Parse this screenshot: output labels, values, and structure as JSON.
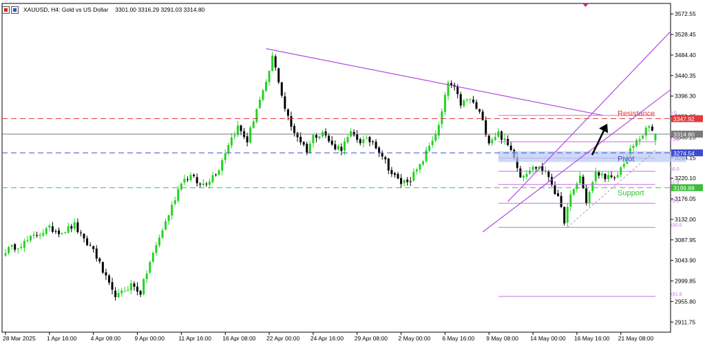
{
  "header": {
    "symbol_desc": "XAUUSD, H4:  Gold vs US Dollar",
    "ohlc": "3301.00 3316.29 3291.03 3314.80"
  },
  "chart_data": {
    "type": "candlestick",
    "symbol": "XAUUSD",
    "timeframe": "H4",
    "description": "Gold vs US Dollar",
    "open": 3301.0,
    "high": 3316.29,
    "low": 3291.03,
    "close": 3314.8,
    "y_ticks": [
      3572.55,
      3528.45,
      3484.4,
      3440.35,
      3396.3,
      3352.25,
      3308.2,
      3264.15,
      3220.1,
      3176.05,
      3132.0,
      3087.95,
      3043.9,
      2999.85,
      2955.8,
      2911.75
    ],
    "ylim": [
      2890,
      3595
    ],
    "x_tick_labels": [
      "28 Mar 2025",
      "1 Apr 16:00",
      "4 Apr 08:00",
      "9 Apr 00:00",
      "11 Apr 16:00",
      "16 Apr 08:00",
      "22 Apr 00:00",
      "24 Apr 16:00",
      "29 Apr 08:00",
      "2 May 00:00",
      "6 May 16:00",
      "9 May 08:00",
      "14 May 00:00",
      "16 May 16:00",
      "21 May 08:00"
    ],
    "x_tick_index": [
      0,
      14,
      28,
      42,
      56,
      70,
      84,
      98,
      112,
      126,
      140,
      154,
      168,
      182,
      196
    ],
    "n_bars": 208,
    "close_anchors": [
      [
        0,
        3065
      ],
      [
        6,
        3082
      ],
      [
        10,
        3100
      ],
      [
        14,
        3112
      ],
      [
        18,
        3105
      ],
      [
        22,
        3120
      ],
      [
        25,
        3085
      ],
      [
        28,
        3068
      ],
      [
        31,
        3020
      ],
      [
        34,
        2975
      ],
      [
        36,
        2968
      ],
      [
        40,
        2992
      ],
      [
        43,
        2975
      ],
      [
        46,
        3040
      ],
      [
        50,
        3110
      ],
      [
        53,
        3160
      ],
      [
        56,
        3215
      ],
      [
        59,
        3225
      ],
      [
        62,
        3205
      ],
      [
        65,
        3218
      ],
      [
        68,
        3242
      ],
      [
        71,
        3295
      ],
      [
        74,
        3330
      ],
      [
        77,
        3300
      ],
      [
        80,
        3370
      ],
      [
        83,
        3420
      ],
      [
        85,
        3480
      ],
      [
        87,
        3430
      ],
      [
        89,
        3370
      ],
      [
        91,
        3330
      ],
      [
        94,
        3300
      ],
      [
        96,
        3280
      ],
      [
        98,
        3310
      ],
      [
        101,
        3320
      ],
      [
        104,
        3290
      ],
      [
        107,
        3285
      ],
      [
        110,
        3315
      ],
      [
        113,
        3300
      ],
      [
        117,
        3300
      ],
      [
        120,
        3270
      ],
      [
        123,
        3230
      ],
      [
        126,
        3210
      ],
      [
        129,
        3220
      ],
      [
        132,
        3245
      ],
      [
        135,
        3290
      ],
      [
        138,
        3330
      ],
      [
        141,
        3425
      ],
      [
        143,
        3410
      ],
      [
        145,
        3380
      ],
      [
        148,
        3390
      ],
      [
        151,
        3360
      ],
      [
        154,
        3300
      ],
      [
        157,
        3318
      ],
      [
        160,
        3290
      ],
      [
        162,
        3270
      ],
      [
        164,
        3225
      ],
      [
        167,
        3240
      ],
      [
        170,
        3245
      ],
      [
        173,
        3225
      ],
      [
        176,
        3175
      ],
      [
        178,
        3130
      ],
      [
        180,
        3180
      ],
      [
        183,
        3225
      ],
      [
        185,
        3170
      ],
      [
        188,
        3230
      ],
      [
        191,
        3225
      ],
      [
        194,
        3215
      ],
      [
        197,
        3255
      ],
      [
        200,
        3290
      ],
      [
        203,
        3315
      ],
      [
        205,
        3330
      ],
      [
        207,
        3314
      ]
    ],
    "price_lines": [
      {
        "name": "Resistance",
        "price": 3347.92,
        "label": "3347.92",
        "color": "#e23a3a"
      },
      {
        "name": "current",
        "price": 3314.8,
        "label": "3314.80",
        "color": "#7a7a7a"
      },
      {
        "name": "Pivot",
        "price": 3274.54,
        "label": "3274.54",
        "color": "#3b4ccf"
      },
      {
        "name": "Support",
        "price": 3199.88,
        "label": "3199.88",
        "color": "#3bbf3b"
      }
    ],
    "annotations": [
      {
        "text": "Resistance",
        "price": 3347.92,
        "color": "#e23a3a"
      },
      {
        "text": "Pivot",
        "price": 3274.54,
        "color": "#3b4ccf"
      },
      {
        "text": "Support",
        "price": 3199.88,
        "color": "#3bbf3b"
      }
    ],
    "fibonacci": {
      "high": 3355.0,
      "low": 3115.0,
      "color": "#c86ee8",
      "levels": [
        {
          "ratio": 0.0,
          "label": "0.0"
        },
        {
          "ratio": 0.236,
          "label": "23.6"
        },
        {
          "ratio": 0.382,
          "label": "38.2"
        },
        {
          "ratio": 0.5,
          "label": "50.0"
        },
        {
          "ratio": 0.618,
          "label": "61.8"
        },
        {
          "ratio": 0.786,
          "label": "78.6"
        },
        {
          "ratio": 1.0,
          "label": "100.0"
        },
        {
          "ratio": 1.618,
          "label": "161.8"
        }
      ]
    },
    "colors": {
      "bull": "#22d422",
      "bear": "#000000",
      "grid": "#d9d9d9",
      "trendline": "#b04be0",
      "arrow": "#000000",
      "pivot_zone": "#b7c9f5"
    }
  }
}
